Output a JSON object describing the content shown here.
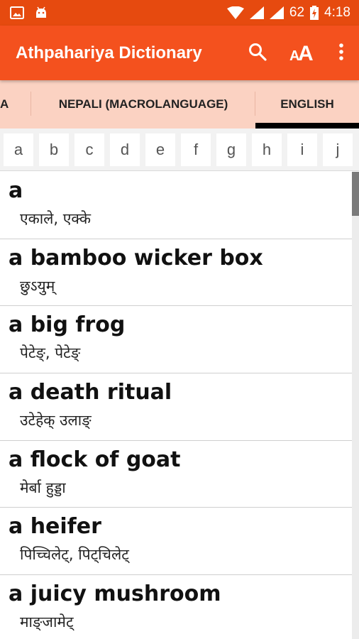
{
  "status_bar": {
    "battery": "62",
    "time": "4:18",
    "icons": [
      "image-icon",
      "android-icon",
      "wifi-icon",
      "signal-icon",
      "signal-icon",
      "battery-icon"
    ]
  },
  "app_bar": {
    "title": "Athpahariya Dictionary",
    "actions": [
      "search-icon",
      "font-size-icon",
      "more-vert-icon"
    ]
  },
  "tabs": [
    {
      "label": "A",
      "active": false
    },
    {
      "label": "NEPALI (MACROLANGUAGE)",
      "active": false
    },
    {
      "label": "ENGLISH",
      "active": true
    }
  ],
  "alphabet": [
    "a",
    "b",
    "c",
    "d",
    "e",
    "f",
    "g",
    "h",
    "i",
    "j"
  ],
  "entries": [
    {
      "word": "a",
      "definition": "एकाले, एक्के"
    },
    {
      "word": "a bamboo wicker box",
      "definition": "छुऽयुम्"
    },
    {
      "word": "a big frog",
      "definition": "पेटेङ्, पेटेङ्"
    },
    {
      "word": "a death ritual",
      "definition": "उटेहेक् उलाङ्"
    },
    {
      "word": "a flock of goat",
      "definition": "मेर्बा हुड्डा"
    },
    {
      "word": "a heifer",
      "definition": "पिच्चिलेट्, पिट्चिलेट्"
    },
    {
      "word": "a juicy mushroom",
      "definition": "माङ्जामेट्"
    }
  ],
  "colors": {
    "status_bar": "#e64a0f",
    "app_bar": "#f4511e",
    "tabs_bg": "#fbd2c2",
    "active_indicator": "#000000"
  }
}
